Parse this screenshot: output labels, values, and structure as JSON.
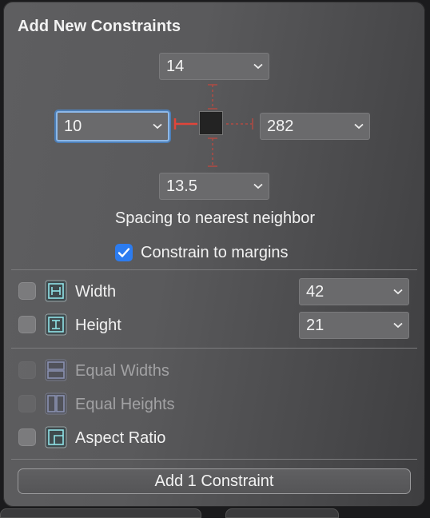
{
  "title": "Add New Constraints",
  "spacing": {
    "top": "14",
    "left": "10",
    "right": "282",
    "bottom": "13.5",
    "label": "Spacing to nearest neighbor"
  },
  "constrain_to_margins": {
    "label": "Constrain to margins",
    "checked": true
  },
  "size_rows": [
    {
      "label": "Width",
      "value": "42",
      "checked": false,
      "icon": "width-constraint-icon"
    },
    {
      "label": "Height",
      "value": "21",
      "checked": false,
      "icon": "height-constraint-icon"
    }
  ],
  "equal_rows": [
    {
      "label": "Equal Widths",
      "enabled": false,
      "icon": "equal-widths-icon"
    },
    {
      "label": "Equal Heights",
      "enabled": false,
      "icon": "equal-heights-icon"
    },
    {
      "label": "Aspect Ratio",
      "enabled": true,
      "icon": "aspect-ratio-icon"
    }
  ],
  "add_button_label": "Add 1 Constraint",
  "colors": {
    "accent": "#2c7cf0",
    "active_strut": "#e0453a",
    "inactive_strut": "#b04a42",
    "icon_teal": "#8fe3e8"
  }
}
